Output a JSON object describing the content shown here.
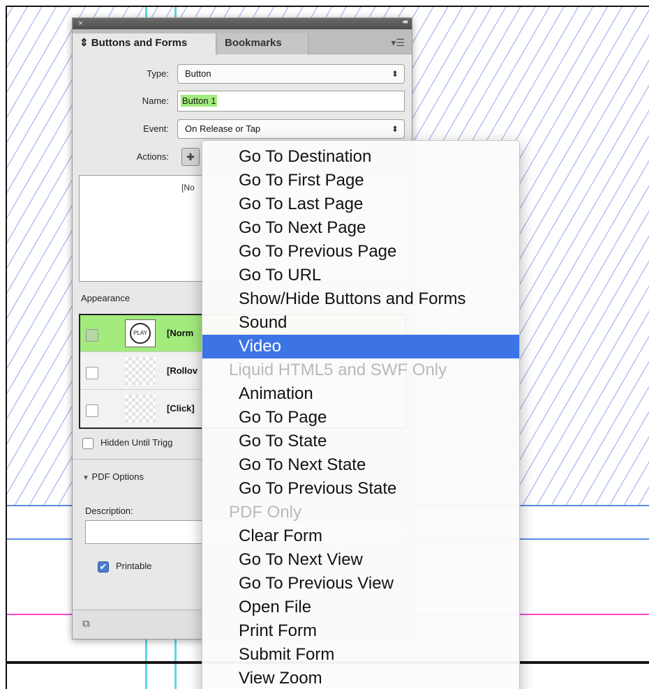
{
  "panel": {
    "tabs": [
      {
        "label": "Buttons and Forms",
        "prefix": "⇕"
      },
      {
        "label": "Bookmarks"
      }
    ],
    "type_label": "Type:",
    "type_value": "Button",
    "name_label": "Name:",
    "name_value": "Button 1",
    "event_label": "Event:",
    "event_value": "On Release or Tap",
    "actions_label": "Actions:",
    "actions_empty": "[No",
    "appearance_label": "Appearance",
    "appearance_rows": [
      {
        "label": "[Norm",
        "thumb_text": "PLAY"
      },
      {
        "label": "[Rollov"
      },
      {
        "label": "[Click]"
      }
    ],
    "hidden_until_triggered_label": "Hidden Until Trigg",
    "pdf_options_label": "PDF Options",
    "description_label": "Description:",
    "printable_label": "Printable"
  },
  "menu": {
    "items": [
      {
        "label": "Go To Destination",
        "kind": "item"
      },
      {
        "label": "Go To First Page",
        "kind": "item"
      },
      {
        "label": "Go To Last Page",
        "kind": "item"
      },
      {
        "label": "Go To Next Page",
        "kind": "item"
      },
      {
        "label": "Go To Previous Page",
        "kind": "item"
      },
      {
        "label": "Go To URL",
        "kind": "item"
      },
      {
        "label": "Show/Hide Buttons and Forms",
        "kind": "item"
      },
      {
        "label": "Sound",
        "kind": "item"
      },
      {
        "label": "Video",
        "kind": "item",
        "highlighted": true
      },
      {
        "label": "Liquid HTML5 and SWF Only",
        "kind": "section"
      },
      {
        "label": "Animation",
        "kind": "item"
      },
      {
        "label": "Go To Page",
        "kind": "item"
      },
      {
        "label": "Go To State",
        "kind": "item"
      },
      {
        "label": "Go To Next State",
        "kind": "item"
      },
      {
        "label": "Go To Previous State",
        "kind": "item"
      },
      {
        "label": "PDF Only",
        "kind": "section"
      },
      {
        "label": "Clear Form",
        "kind": "item"
      },
      {
        "label": "Go To Next View",
        "kind": "item"
      },
      {
        "label": "Go To Previous View",
        "kind": "item"
      },
      {
        "label": "Open File",
        "kind": "item"
      },
      {
        "label": "Print Form",
        "kind": "item"
      },
      {
        "label": "Submit Form",
        "kind": "item"
      },
      {
        "label": "View Zoom",
        "kind": "item"
      }
    ]
  },
  "colors": {
    "highlight": "#3c74e6",
    "selection_green": "#a3eb7d",
    "guide_blue": "#5b8be6",
    "guide_magenta": "#ff46d8",
    "guide_cyan": "#5ed8e2"
  }
}
